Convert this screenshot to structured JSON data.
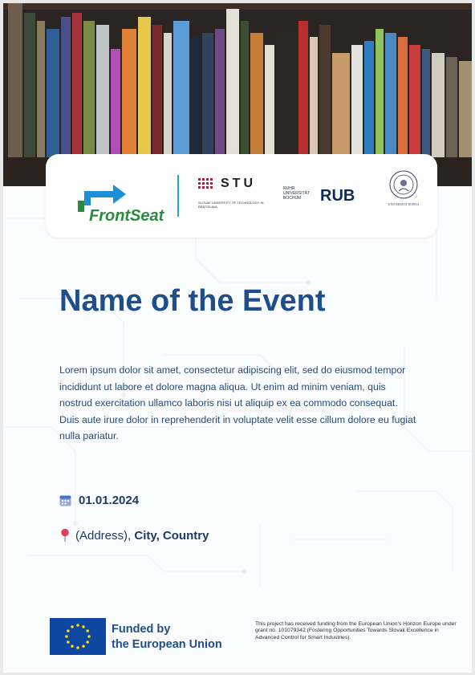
{
  "partners": {
    "frontseat": "FrontSeat",
    "stu": {
      "name": "STU",
      "sub": "SLOVAK UNIVERSITY OF TECHNOLOGY IN BRATISLAVA"
    },
    "rub": {
      "small": "RUHR UNIVERSITÄT BOCHUM",
      "big": "RUB"
    },
    "pisa": "UNIVERSITÀ DI PISA"
  },
  "event": {
    "title": "Name of the Event",
    "description": "Lorem ipsum dolor sit amet, consectetur adipiscing elit, sed do eiusmod tempor incididunt ut labore et dolore magna aliqua. Ut enim ad minim veniam, quis nostrud exercitation ullamco laboris nisi ut aliquip ex ea commodo consequat. Duis aute irure dolor in reprehenderit in voluptate velit esse cillum dolore eu fugiat nulla pariatur.",
    "date": "01.01.2024",
    "address_plain": "(Address),",
    "address_bold": "City, Country"
  },
  "footer": {
    "funded_line1": "Funded by",
    "funded_line2": "the European Union",
    "project_text": "This project has received funding from the European Union's Horizon Europe under grant no. 101079342 (Fostering Opportunities Towards Slovak Excellence in Advanced Control for Smart Industries)."
  },
  "colors": {
    "title": "#1f4e8c",
    "eu_blue": "#0e47a1",
    "eu_star": "#ffdd00",
    "frontseat_green": "#2b8a3e",
    "frontseat_blue": "#1d8fd6"
  },
  "icons": {
    "date": "calendar-icon",
    "address": "map-pin-icon"
  }
}
